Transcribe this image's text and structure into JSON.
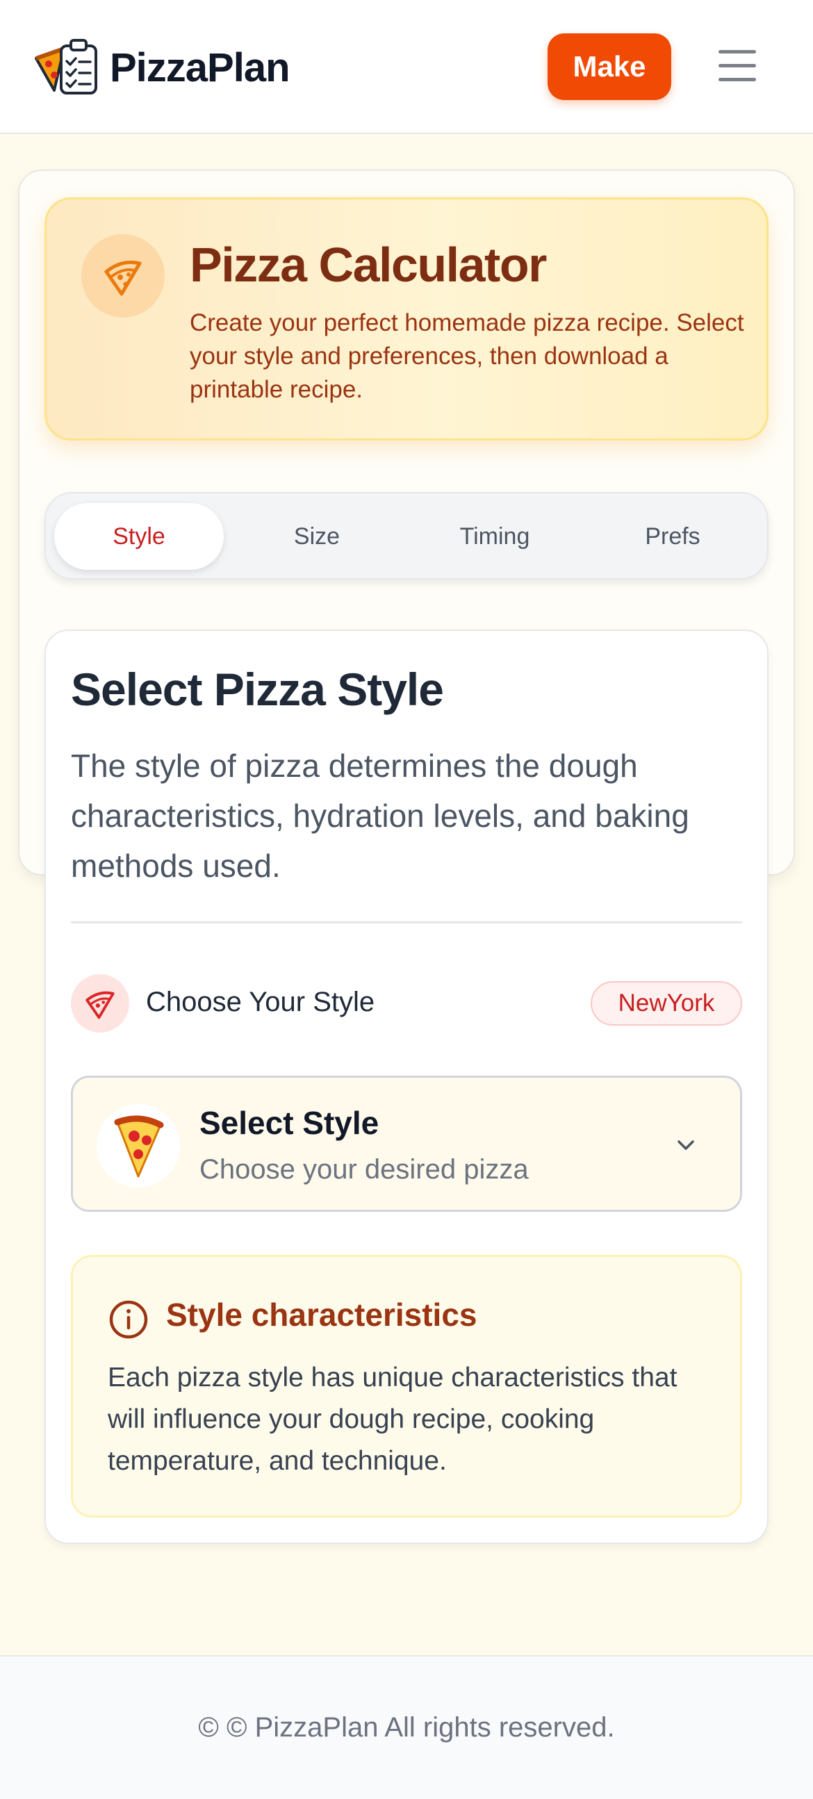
{
  "header": {
    "brand": "PizzaPlan",
    "make_label": "Make",
    "menu_icon": "hamburger-menu-icon",
    "logo_icon": "pizza-clipboard-logo"
  },
  "hero": {
    "title": "Pizza Calculator",
    "description": "Create your perfect homemade pizza recipe. Select your style and preferences, then download a printable recipe.",
    "icon": "pizza-slice-icon"
  },
  "tabs": [
    {
      "label": "Style",
      "active": true
    },
    {
      "label": "Size",
      "active": false
    },
    {
      "label": "Timing",
      "active": false
    },
    {
      "label": "Prefs",
      "active": false
    }
  ],
  "style_section": {
    "title": "Select Pizza Style",
    "description": "The style of pizza determines the dough characteristics, hydration levels, and baking methods used.",
    "choose_label": "Choose Your Style",
    "selected_badge": "NewYork",
    "select": {
      "emoji": "🍕",
      "title": "Select Style",
      "subtitle": "Choose your desired pizza"
    },
    "info": {
      "title": "Style characteristics",
      "text": "Each pizza style has unique characteristics that will influence your dough recipe, cooking temperature, and technique."
    }
  },
  "footer": {
    "text": "© © PizzaPlan All rights reserved."
  },
  "colors": {
    "accent": "#f04a05",
    "active_tab": "#c81e1e",
    "hero_title": "#7c2d12",
    "page_bg": "#fffbec"
  }
}
